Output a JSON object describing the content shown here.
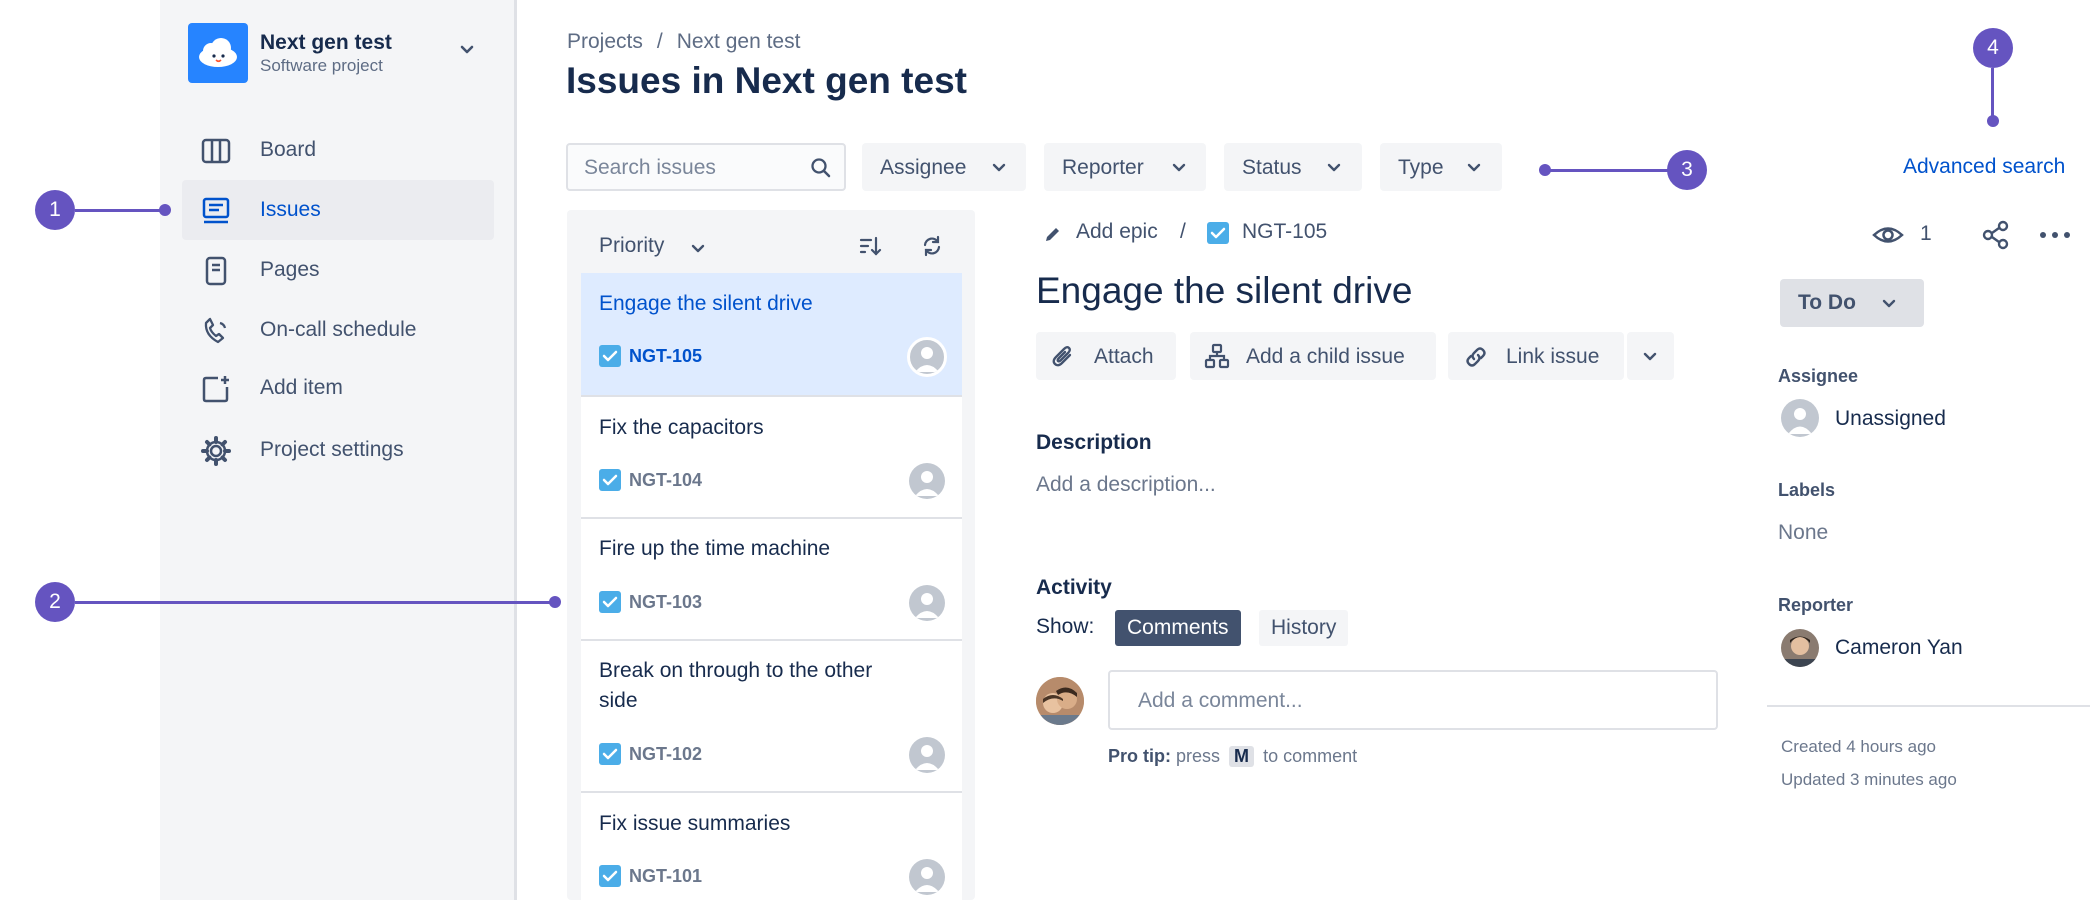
{
  "project": {
    "name": "Next gen test",
    "type": "Software project"
  },
  "sidebar": {
    "items": [
      {
        "label": "Board",
        "icon": "board-icon"
      },
      {
        "label": "Issues",
        "icon": "issues-icon",
        "active": true
      },
      {
        "label": "Pages",
        "icon": "pages-icon"
      },
      {
        "label": "On-call schedule",
        "icon": "phone-icon"
      },
      {
        "label": "Add item",
        "icon": "add-item-icon"
      },
      {
        "label": "Project settings",
        "icon": "gear-icon"
      }
    ]
  },
  "callouts": [
    "1",
    "2",
    "3",
    "4"
  ],
  "breadcrumb": [
    "Projects",
    "/",
    "Next gen test"
  ],
  "page_title": "Issues in Next gen test",
  "filters": {
    "search_placeholder": "Search issues",
    "buttons": [
      "Assignee",
      "Reporter",
      "Status",
      "Type"
    ],
    "advanced_search": "Advanced search"
  },
  "issue_list": {
    "sort_label": "Priority",
    "issues": [
      {
        "title": "Engage the silent drive",
        "key": "NGT-105",
        "selected": true
      },
      {
        "title": "Fix the capacitors",
        "key": "NGT-104"
      },
      {
        "title": "Fire up the time machine",
        "key": "NGT-103"
      },
      {
        "title": "Break on through to the other side",
        "key": "NGT-102"
      },
      {
        "title": "Fix issue summaries",
        "key": "NGT-101"
      }
    ]
  },
  "detail": {
    "add_epic": "Add epic",
    "separator": "/",
    "key": "NGT-105",
    "title": "Engage the silent drive",
    "actions": {
      "attach": "Attach",
      "add_child": "Add a child issue",
      "link_issue": "Link issue"
    },
    "description_heading": "Description",
    "description_placeholder": "Add a description...",
    "activity_heading": "Activity",
    "show_label": "Show:",
    "tabs": {
      "comments": "Comments",
      "history": "History"
    },
    "comment_placeholder": "Add a comment...",
    "protip": {
      "label": "Pro tip:",
      "press": "press",
      "key": "M",
      "suffix": "to comment"
    }
  },
  "side_panel": {
    "watchers": "1",
    "status": "To Do",
    "assignee_label": "Assignee",
    "assignee": "Unassigned",
    "labels_label": "Labels",
    "labels": "None",
    "reporter_label": "Reporter",
    "reporter": "Cameron Yan",
    "created": "Created 4 hours ago",
    "updated": "Updated 3 minutes ago"
  },
  "colors": {
    "accent": "#6554c0",
    "link": "#0052cc",
    "selected": "#deebff",
    "task": "#4bade8"
  }
}
